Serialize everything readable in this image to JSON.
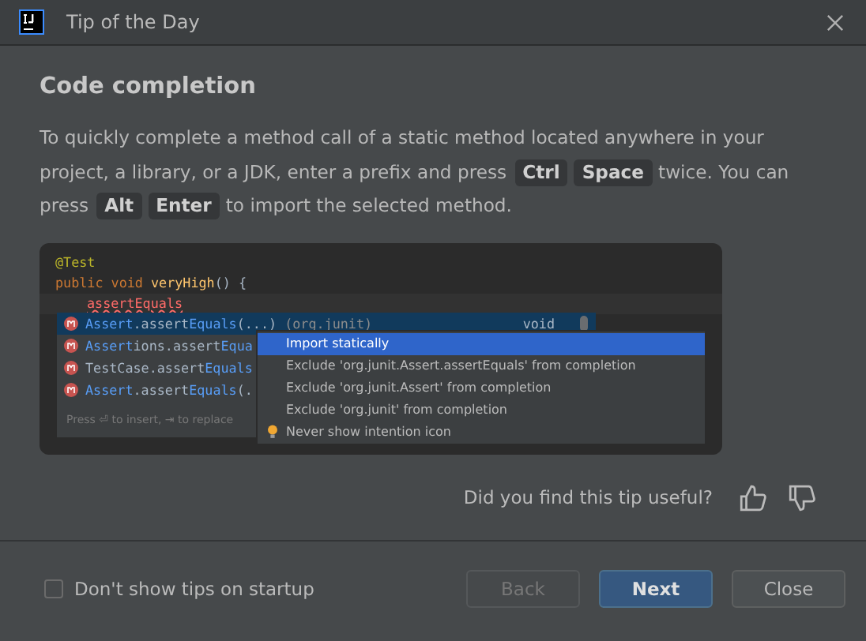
{
  "window": {
    "title": "Tip of the Day"
  },
  "tip": {
    "heading": "Code completion",
    "parts": [
      {
        "kind": "text",
        "text": "To quickly complete a method call of a static method located anywhere in your project, a library, or a JDK, enter a prefix and press"
      },
      {
        "kind": "key",
        "text": "Ctrl"
      },
      {
        "kind": "key",
        "text": "Space"
      },
      {
        "kind": "text",
        "text": "twice. You can press"
      },
      {
        "kind": "key",
        "text": "Alt"
      },
      {
        "kind": "key",
        "text": "Enter"
      },
      {
        "kind": "text",
        "text": "to import the selected method."
      }
    ]
  },
  "code_example": {
    "lines": [
      [
        {
          "kind": "annotation",
          "text": "@Test"
        }
      ],
      [
        {
          "kind": "keyword",
          "text": "public void "
        },
        {
          "kind": "method",
          "text": "veryHigh"
        },
        {
          "kind": "plain",
          "text": "() {"
        }
      ],
      [
        {
          "kind": "error",
          "text": "assertEquals"
        }
      ]
    ],
    "completions": [
      {
        "selected": true,
        "segments": [
          {
            "kind": "match",
            "text": "Assert"
          },
          {
            "kind": "plain",
            "text": ".assert"
          },
          {
            "kind": "match",
            "text": "Equals"
          },
          {
            "kind": "plain",
            "text": "(...)"
          },
          {
            "kind": "hint",
            "text": " (org.junit)"
          }
        ],
        "type": "void"
      },
      {
        "selected": false,
        "segments": [
          {
            "kind": "match",
            "text": "Assert"
          },
          {
            "kind": "plain",
            "text": "ions.assert"
          },
          {
            "kind": "match",
            "text": "Equa"
          }
        ]
      },
      {
        "selected": false,
        "segments": [
          {
            "kind": "plain",
            "text": "TestCase.assert"
          },
          {
            "kind": "match",
            "text": "Equals"
          }
        ]
      },
      {
        "selected": false,
        "segments": [
          {
            "kind": "match",
            "text": "Assert"
          },
          {
            "kind": "plain",
            "text": ".assert"
          },
          {
            "kind": "match",
            "text": "Equals"
          },
          {
            "kind": "plain",
            "text": "(."
          }
        ]
      }
    ],
    "completion_hint": "Press ⏎ to insert, ⇥ to replace",
    "intentions": [
      {
        "label": "Import statically",
        "selected": true
      },
      {
        "label": "Exclude 'org.junit.Assert.assertEquals' from completion",
        "selected": false
      },
      {
        "label": "Exclude 'org.junit.Assert' from completion",
        "selected": false
      },
      {
        "label": "Exclude 'org.junit' from completion",
        "selected": false
      },
      {
        "label": "Never show intention icon",
        "selected": false,
        "kind": "bulb"
      }
    ]
  },
  "feedback": {
    "question": "Did you find this tip useful?"
  },
  "footer": {
    "checkbox": {
      "label": "Don't show tips on startup",
      "checked": false
    },
    "buttons": [
      {
        "label": "Back",
        "kind": "default",
        "disabled": true
      },
      {
        "label": "Next",
        "kind": "primary",
        "disabled": false
      },
      {
        "label": "Close",
        "kind": "default",
        "disabled": false
      }
    ]
  }
}
